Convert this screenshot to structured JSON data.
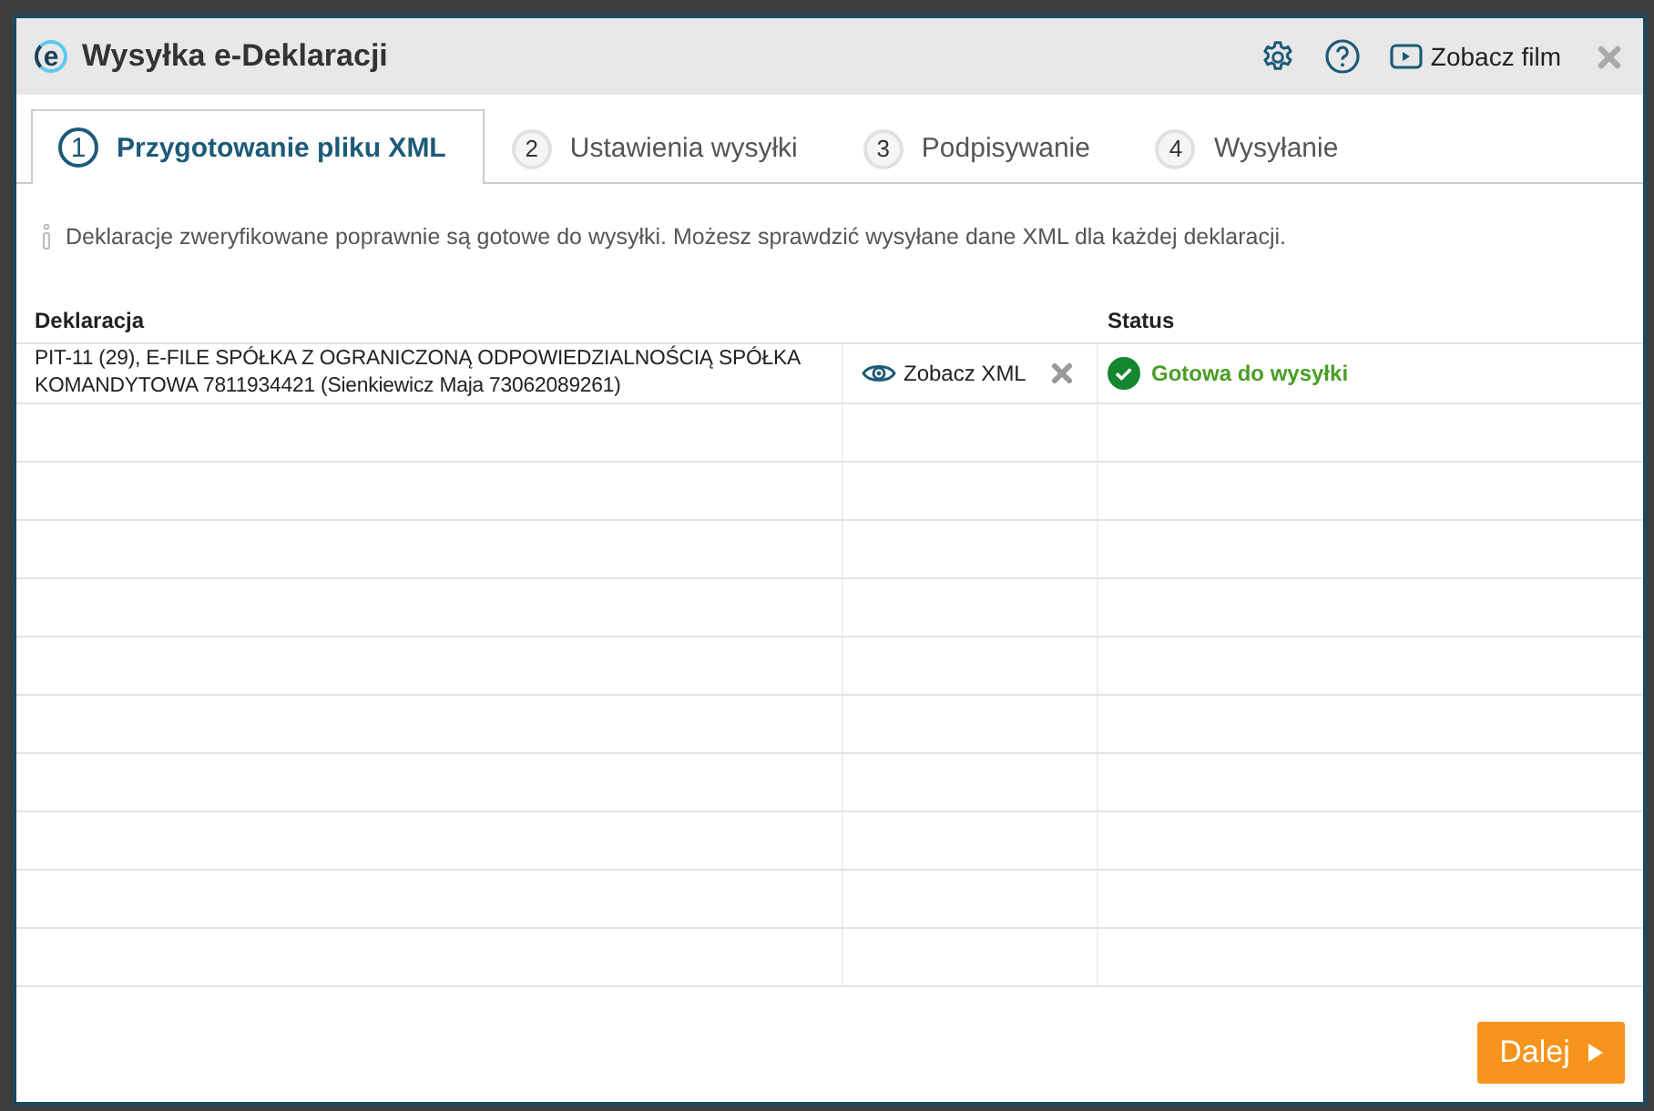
{
  "window": {
    "logo": "e",
    "title": "Wysyłka e-Deklaracji",
    "video_link": "Zobacz film"
  },
  "tabs": [
    {
      "number": "1",
      "label": "Przygotowanie pliku XML",
      "selected": true
    },
    {
      "number": "2",
      "label": "Ustawienia wysyłki",
      "selected": false
    },
    {
      "number": "3",
      "label": "Podpisywanie",
      "selected": false
    },
    {
      "number": "4",
      "label": "Wysyłanie",
      "selected": false
    }
  ],
  "info": "Deklaracje zweryfikowane poprawnie są gotowe do wysyłki. Możesz sprawdzić wysyłane dane XML dla każdej deklaracji.",
  "table": {
    "columns": [
      "Deklaracja",
      "Status"
    ],
    "rows": [
      {
        "declaration": "PIT-11 (29), E-FILE SPÓŁKA Z OGRANICZONĄ ODPOWIEDZIALNOŚCIĄ SPÓŁKA KOMANDYTOWA 7811934421 (Sienkiewicz Maja 73062089261)",
        "view_link": "Zobacz XML",
        "status": "Gotowa do wysyłki",
        "ready": true
      }
    ]
  },
  "buttons": {
    "next": "Dalej"
  }
}
